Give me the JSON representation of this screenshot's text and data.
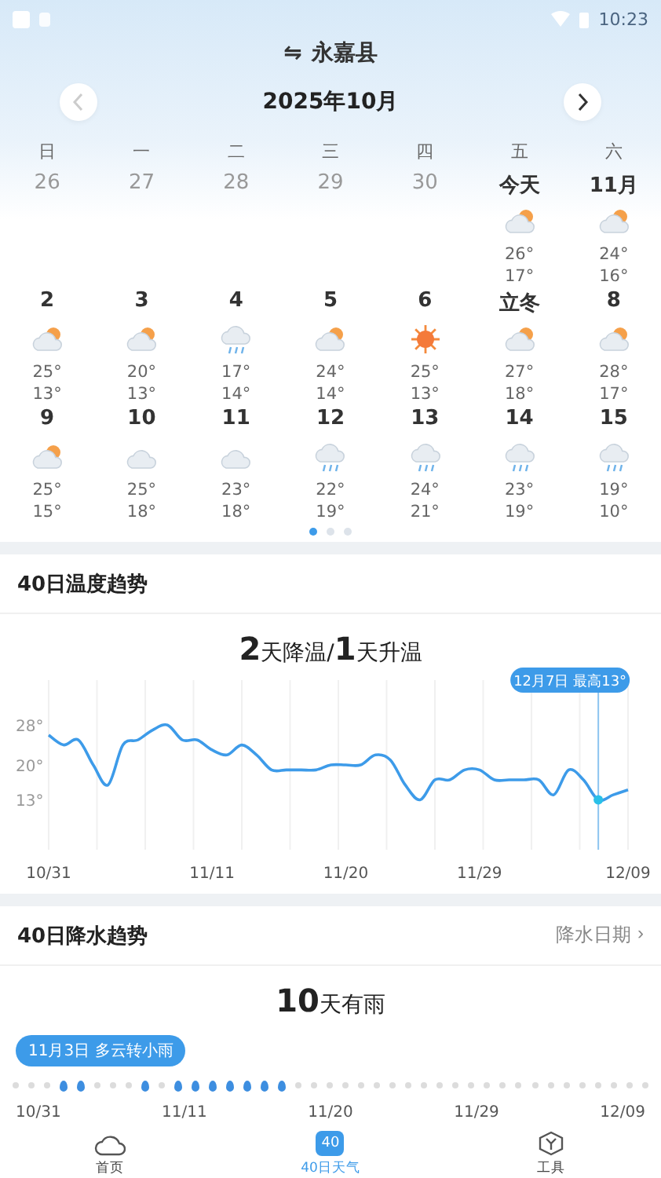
{
  "status_bar": {
    "time": "10:23"
  },
  "header": {
    "switch_icon": "⇋",
    "location": "永嘉县",
    "month": "2025年10月"
  },
  "calendar": {
    "weekdays": [
      "日",
      "一",
      "二",
      "三",
      "四",
      "五",
      "六"
    ],
    "weeks": [
      [
        {
          "label": "26",
          "muted": true
        },
        {
          "label": "27",
          "muted": true
        },
        {
          "label": "28",
          "muted": true
        },
        {
          "label": "29",
          "muted": true
        },
        {
          "label": "30",
          "muted": true
        },
        {
          "label": "今天",
          "muted": false,
          "kind": "partly",
          "high": "26°",
          "low": "17°"
        },
        {
          "label": "11月",
          "muted": false,
          "kind": "partly",
          "high": "24°",
          "low": "16°"
        }
      ],
      [
        {
          "label": "2",
          "muted": false,
          "kind": "partly",
          "high": "25°",
          "low": "13°"
        },
        {
          "label": "3",
          "muted": false,
          "kind": "partly",
          "high": "20°",
          "low": "13°"
        },
        {
          "label": "4",
          "muted": false,
          "kind": "rain",
          "high": "17°",
          "low": "14°"
        },
        {
          "label": "5",
          "muted": false,
          "kind": "partly",
          "high": "24°",
          "low": "14°"
        },
        {
          "label": "6",
          "muted": false,
          "kind": "sunny",
          "high": "25°",
          "low": "13°"
        },
        {
          "label": "立冬",
          "muted": false,
          "kind": "partly",
          "high": "27°",
          "low": "18°"
        },
        {
          "label": "8",
          "muted": false,
          "kind": "partly",
          "high": "28°",
          "low": "17°"
        }
      ],
      [
        {
          "label": "9",
          "muted": false,
          "kind": "partly",
          "high": "25°",
          "low": "15°"
        },
        {
          "label": "10",
          "muted": false,
          "kind": "cloudy",
          "high": "25°",
          "low": "18°"
        },
        {
          "label": "11",
          "muted": false,
          "kind": "cloudy",
          "high": "23°",
          "low": "18°"
        },
        {
          "label": "12",
          "muted": false,
          "kind": "rain",
          "high": "22°",
          "low": "19°"
        },
        {
          "label": "13",
          "muted": false,
          "kind": "rain",
          "high": "24°",
          "low": "21°"
        },
        {
          "label": "14",
          "muted": false,
          "kind": "rain",
          "high": "23°",
          "low": "19°"
        },
        {
          "label": "15",
          "muted": false,
          "kind": "rain",
          "high": "19°",
          "low": "10°"
        }
      ]
    ],
    "pages": [
      {
        "selected": true
      },
      {
        "selected": false
      },
      {
        "selected": false
      }
    ]
  },
  "temperature_trend": {
    "title": "40日温度趋势",
    "summary": "**2**天降温/**1**天升温",
    "chart_data": {
      "type": "line",
      "categories": [
        "10/31",
        null,
        null,
        null,
        null,
        null,
        null,
        null,
        null,
        null,
        null,
        "11/11",
        null,
        null,
        null,
        null,
        null,
        null,
        null,
        null,
        "11/20",
        null,
        null,
        null,
        null,
        null,
        null,
        null,
        null,
        "11/29",
        null,
        null,
        null,
        null,
        null,
        null,
        null,
        null,
        null,
        "12/09"
      ],
      "series": [
        {
          "color": "#3d9be9",
          "values": [
            26,
            24,
            25,
            20,
            16,
            24,
            25,
            27,
            28,
            25,
            25,
            23,
            22,
            24,
            22,
            19,
            19,
            19,
            19,
            20,
            20,
            20,
            22,
            21,
            16,
            13,
            17,
            17,
            19,
            19,
            17,
            17,
            17,
            17,
            14,
            19,
            17,
            13,
            14,
            15
          ]
        }
      ],
      "grid": true,
      "ylim": [
        3,
        37
      ],
      "yticks": [
        {
          "value": 13,
          "label": "13°"
        },
        {
          "value": 20,
          "label": "20°"
        },
        {
          "value": 28,
          "label": "28°"
        }
      ],
      "annotations": [
        "12月7日 最高13°"
      ]
    }
  },
  "rain_trend": {
    "title": "40日降水趋势",
    "link": "降水日期",
    "link_arrow": "›",
    "summary": "**10**天有雨",
    "tooltip": "11月3日 多云转小雨",
    "rain_days": [
      false,
      false,
      false,
      true,
      true,
      false,
      false,
      false,
      true,
      false,
      true,
      true,
      true,
      true,
      true,
      true,
      true,
      false,
      false,
      false,
      false,
      false,
      false,
      false,
      false,
      false,
      false,
      false,
      false,
      false,
      false,
      false,
      false,
      false,
      false,
      false,
      false,
      false,
      false,
      false
    ],
    "xticks": [
      "10/31",
      "11/11",
      "11/20",
      "11/29",
      "12/09"
    ]
  },
  "nav": [
    {
      "kind": "cloud",
      "label": "首页",
      "selected": false
    },
    {
      "kind": "badge",
      "badge": "40",
      "label": "40日天气",
      "selected": true
    },
    {
      "kind": "tool",
      "label": "工具",
      "selected": false
    }
  ]
}
